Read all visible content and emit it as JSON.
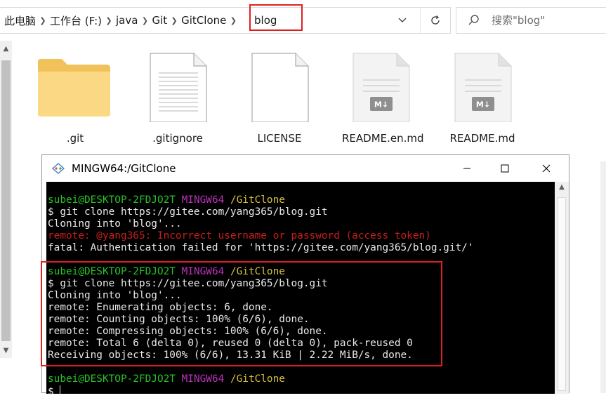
{
  "explorer": {
    "breadcrumbs": [
      "此电脑",
      "工作台 (F:)",
      "java",
      "Git",
      "GitClone"
    ],
    "current_folder": "blog",
    "search_placeholder": "搜索\"blog\"",
    "files": [
      {
        "name": ".git",
        "type": "folder"
      },
      {
        "name": ".gitignore",
        "type": "document"
      },
      {
        "name": "LICENSE",
        "type": "document"
      },
      {
        "name": "README.en.md",
        "type": "markdown"
      },
      {
        "name": "README.md",
        "type": "markdown"
      }
    ]
  },
  "terminal": {
    "title": "MINGW64:/GitClone",
    "prompt": {
      "user": "subei@DESKTOP-2FDJO2T",
      "shell": "MINGW64",
      "path": "/GitClone",
      "symbol": "$"
    },
    "session1": {
      "command": "$ git clone https://gitee.com/yang365/blog.git",
      "lines": [
        "Cloning into 'blog'..."
      ],
      "error_line": "remote: @yang365: Incorrect username or password (access token)",
      "fatal_line": "fatal: Authentication failed for 'https://gitee.com/yang365/blog.git/'"
    },
    "session2": {
      "command": "$ git clone https://gitee.com/yang365/blog.git",
      "lines": [
        "Cloning into 'blog'...",
        "remote: Enumerating objects: 6, done.",
        "remote: Counting objects: 100% (6/6), done.",
        "remote: Compressing objects: 100% (6/6), done.",
        "remote: Total 6 (delta 0), reused 0 (delta 0), pack-reused 0",
        "Receiving objects: 100% (6/6), 13.31 KiB | 2.22 MiB/s, done."
      ]
    },
    "colors": {
      "user": "#27c227",
      "shell": "#bb34bb",
      "path": "#d7c23a",
      "error": "#c81e1e",
      "highlight": "#e02020"
    }
  }
}
